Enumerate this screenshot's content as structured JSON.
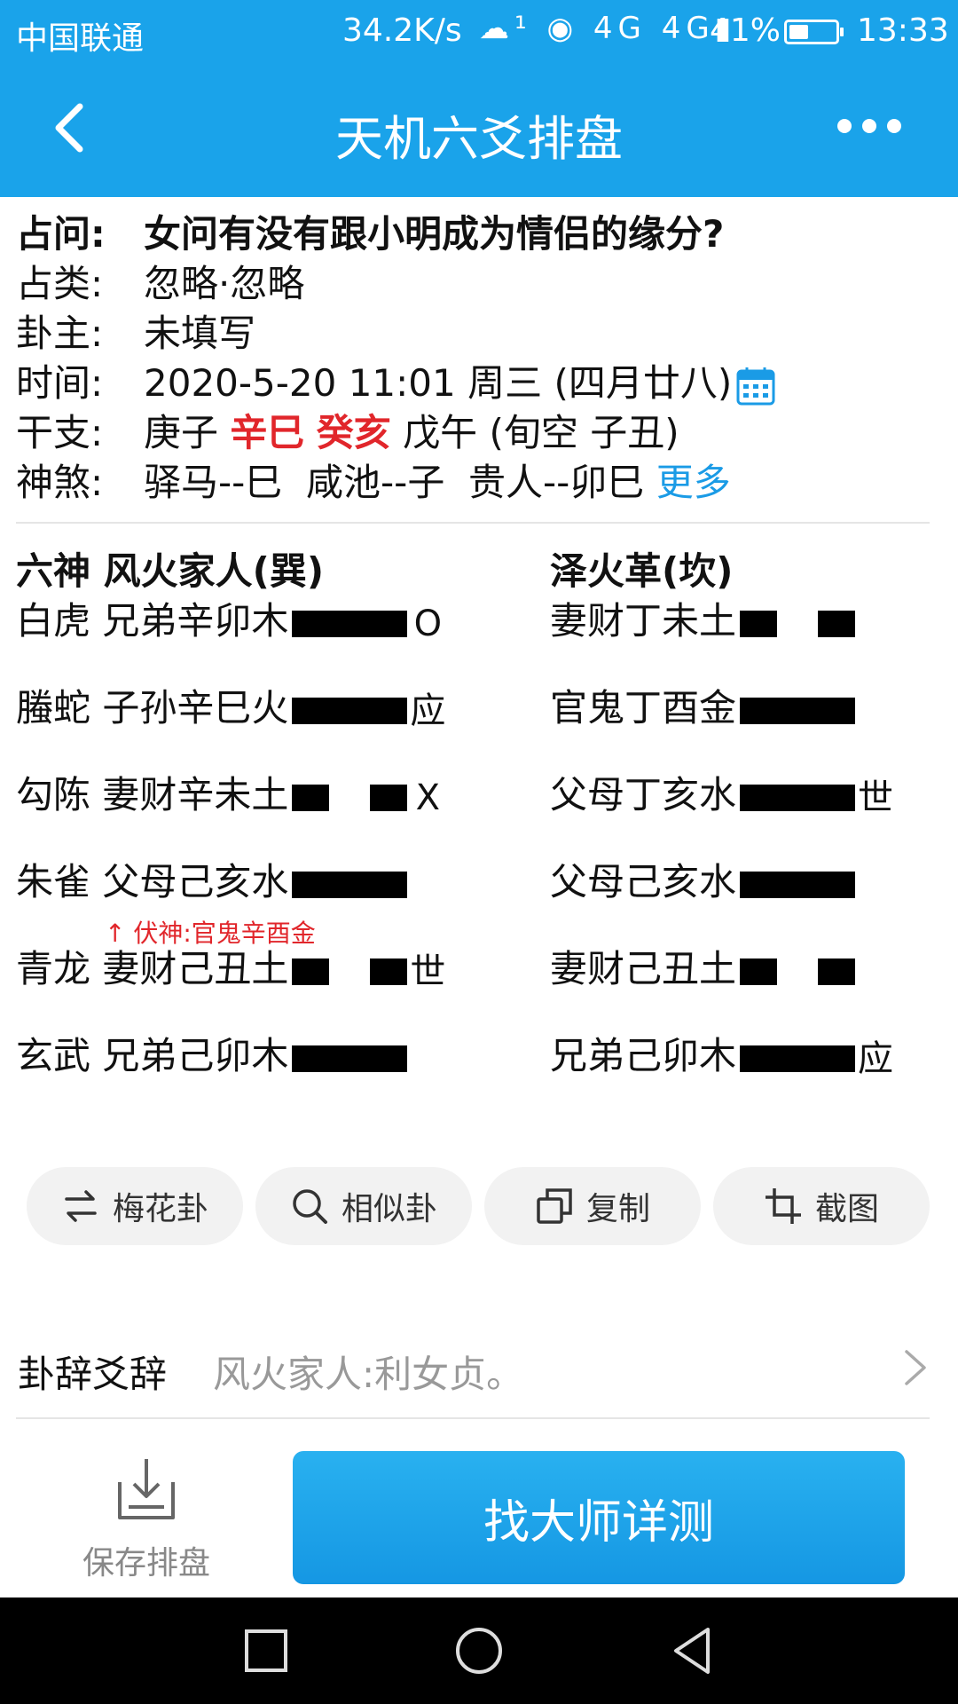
{
  "status_bar": {
    "carrier": "中国联通",
    "speed": "34.2K/s",
    "network_icons": "☁¹ ◉ 4G 4G▮",
    "battery_percent": "41%",
    "battery_level": 0.41,
    "time": "13:33"
  },
  "app_bar": {
    "title": "天机六爻排盘",
    "back_icon": "chevron-left-icon",
    "more_icon": "more-dots-icon"
  },
  "info": {
    "question_label": "占问:",
    "question": "女问有没有跟小明成为情侣的缘分?",
    "category_label": "占类:",
    "category": "忽略·忽略",
    "owner_label": "卦主:",
    "owner": "未填写",
    "time_label": "时间:",
    "time": "2020-5-20 11:01 周三 (四月廿八)",
    "ganzhi_label": "干支:",
    "ganzhi_1": "庚子",
    "ganzhi_2": "辛巳",
    "ganzhi_3": "癸亥",
    "ganzhi_4": "戊午 (旬空 子丑)",
    "shensha_label": "神煞:",
    "shensha": "驿马--巳  咸池--子  贵人--卯巳",
    "more_link": "更多",
    "accent_color": "#e1262b",
    "link_color": "#1a9be6"
  },
  "gua": {
    "left_header": "六神  风火家人(巽)",
    "right_header": "泽火革(坎)",
    "left_lines": [
      {
        "label": "白虎 兄弟辛卯木",
        "line": "yang",
        "mark": "O"
      },
      {
        "label": "螣蛇 子孙辛巳火",
        "line": "yang",
        "mark": "应"
      },
      {
        "label": "勾陈 妻财辛未土",
        "line": "yin",
        "mark": "X"
      },
      {
        "label": "朱雀 父母己亥水",
        "line": "yang",
        "mark": ""
      },
      {
        "label": "青龙 妻财己丑土",
        "line": "yin",
        "mark": "世"
      },
      {
        "label": "玄武 兄弟己卯木",
        "line": "yang",
        "mark": ""
      }
    ],
    "right_lines": [
      {
        "label": "妻财丁未土",
        "line": "yin",
        "mark": ""
      },
      {
        "label": "官鬼丁酉金",
        "line": "yang",
        "mark": ""
      },
      {
        "label": "父母丁亥水",
        "line": "yang",
        "mark": "世"
      },
      {
        "label": "父母己亥水",
        "line": "yang",
        "mark": ""
      },
      {
        "label": "妻财己丑土",
        "line": "yin",
        "mark": ""
      },
      {
        "label": "兄弟己卯木",
        "line": "yang",
        "mark": "应"
      }
    ],
    "fushen_note": "↑ 伏神:官鬼辛酉金"
  },
  "actions": {
    "meihua": "梅花卦",
    "similar": "相似卦",
    "copy": "复制",
    "screenshot": "截图"
  },
  "guaci": {
    "label": "卦辞爻辞",
    "text": "风火家人:利女贞。"
  },
  "bottom": {
    "save_label": "保存排盘",
    "cta_label": "找大师详测"
  }
}
